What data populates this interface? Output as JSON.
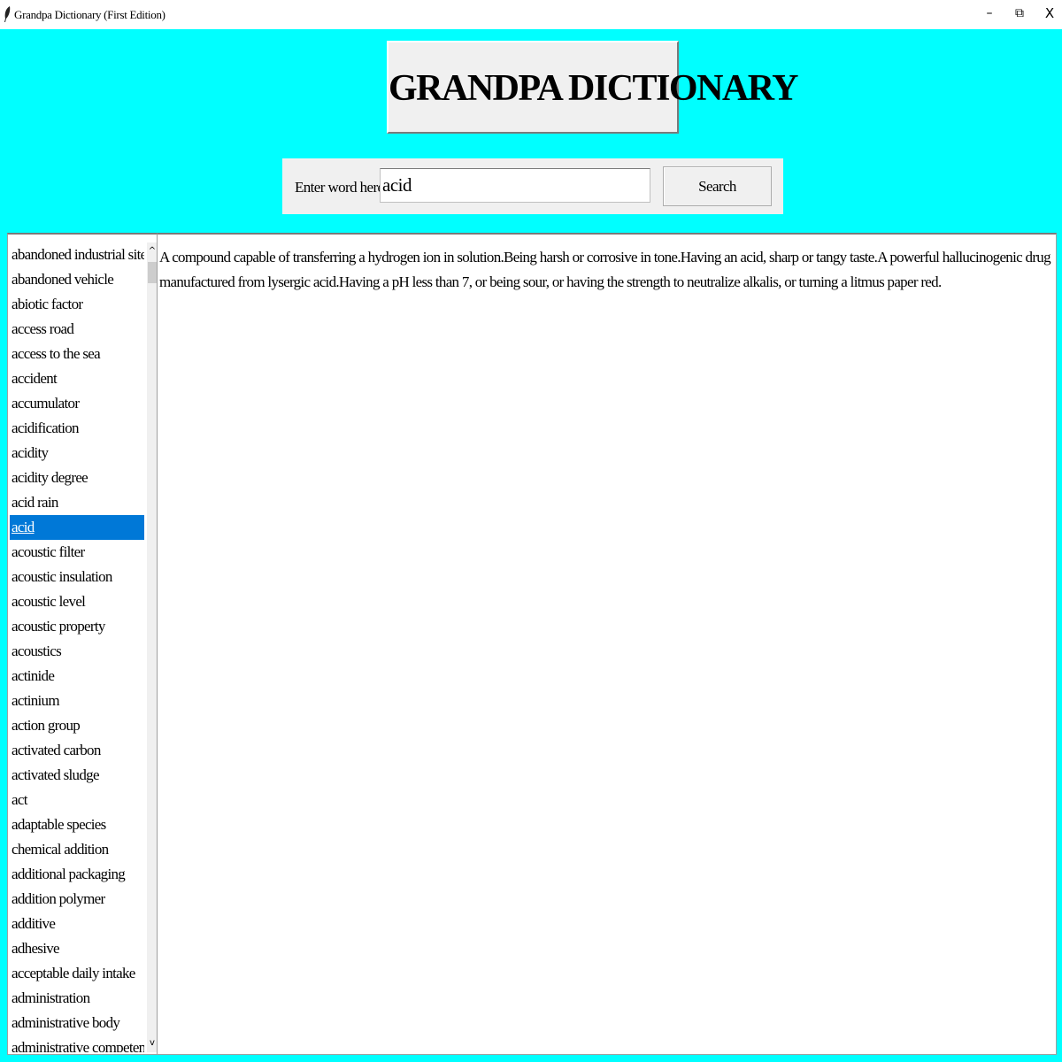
{
  "window": {
    "title": "Grandpa Dictionary (First Edition)",
    "controls": {
      "minimize": "–",
      "restore": "⧉",
      "close": "X"
    }
  },
  "header": {
    "heading": "GRANDPA DICTIONARY"
  },
  "search": {
    "label": "Enter word here:",
    "value": "acid",
    "button_label": "Search"
  },
  "word_list": {
    "selected": "acid",
    "items": [
      "abandoned industrial site",
      "abandoned vehicle",
      "abiotic factor",
      "access road",
      "access to the sea",
      "accident",
      "accumulator",
      "acidification",
      "acidity",
      "acidity degree",
      "acid rain",
      "acid",
      "acoustic filter",
      "acoustic insulation",
      "acoustic level",
      "acoustic property",
      "acoustics",
      "actinide",
      "actinium",
      "action group",
      "activated carbon",
      "activated sludge",
      "act",
      "adaptable species",
      "chemical addition",
      "additional packaging",
      "addition polymer",
      "additive",
      "adhesive",
      "acceptable daily intake",
      "administration",
      "administrative body",
      "administrative competence"
    ],
    "scroll_up": "^",
    "scroll_down": "v"
  },
  "definition": {
    "text": "A compound capable of transferring a hydrogen ion in solution.Being harsh or corrosive in tone.Having an acid, sharp or tangy taste.A powerful hallucinogenic drug manufactured from lysergic acid.Having a pH less than 7, or being sour, or having the strength to neutralize  alkalis, or turning a litmus paper red."
  },
  "colors": {
    "background": "#00ffff",
    "selection": "#0078d7",
    "panel": "#f0f0f0"
  }
}
